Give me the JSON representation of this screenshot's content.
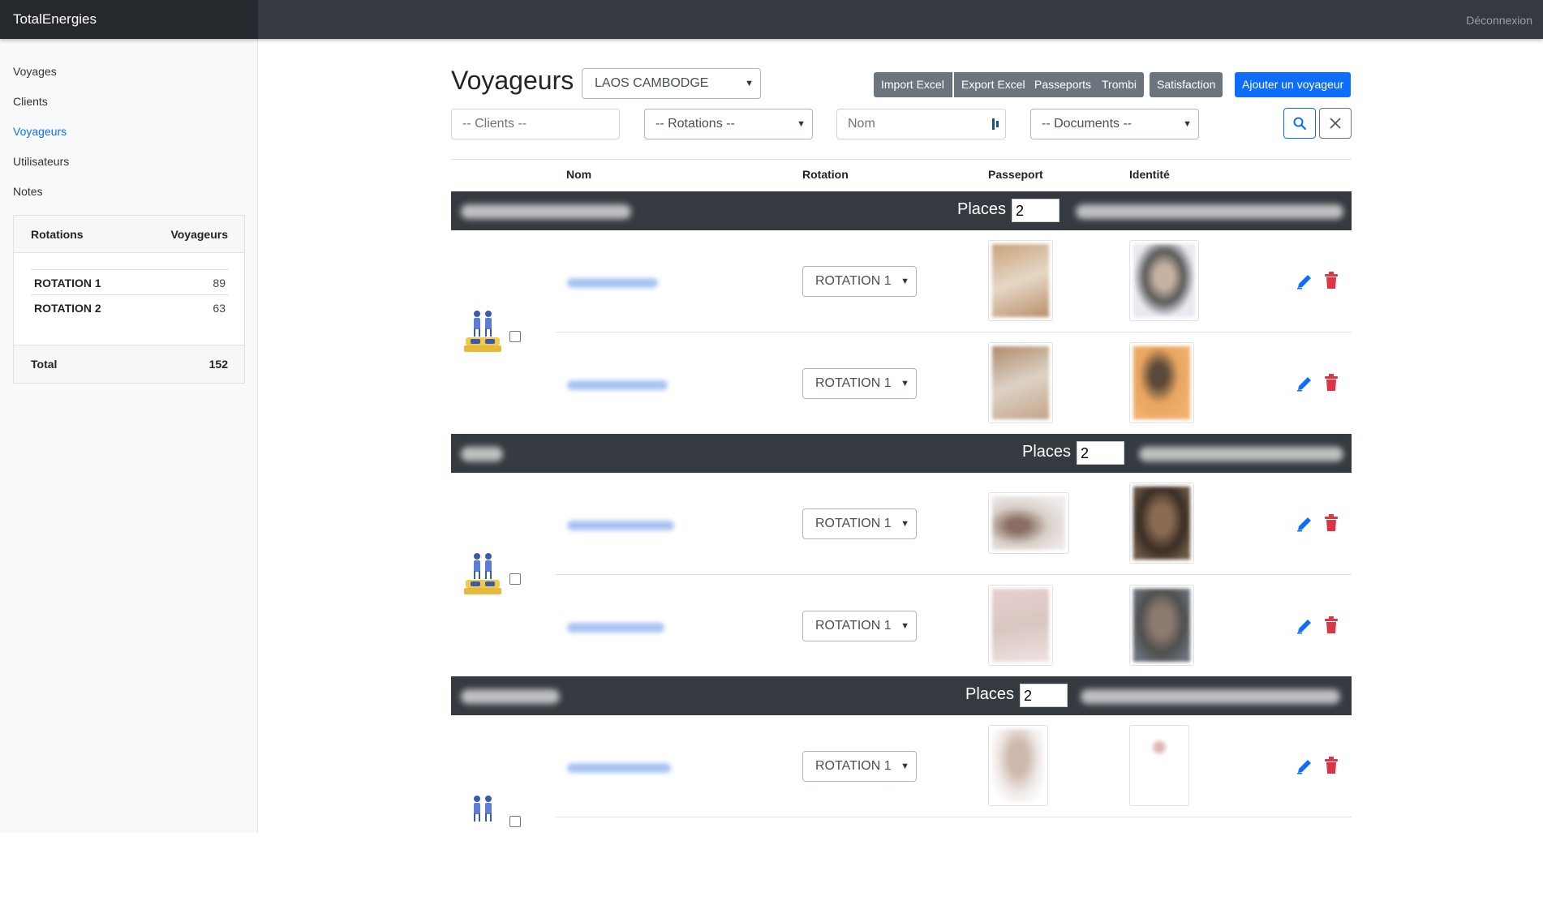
{
  "navbar": {
    "brand": "TotalEnergies",
    "logout": "Déconnexion"
  },
  "sidebar": {
    "items": [
      {
        "label": "Voyages",
        "active": false
      },
      {
        "label": "Clients",
        "active": false
      },
      {
        "label": "Voyageurs",
        "active": true
      },
      {
        "label": "Utilisateurs",
        "active": false
      },
      {
        "label": "Notes",
        "active": false
      }
    ],
    "stats": {
      "col_rotations": "Rotations",
      "col_voyageurs": "Voyageurs",
      "rows": [
        {
          "name": "ROTATION 1",
          "value": "89"
        },
        {
          "name": "ROTATION 2",
          "value": "63"
        }
      ],
      "total_label": "Total",
      "total_value": "152"
    }
  },
  "main": {
    "title": "Voyageurs",
    "trip_select": "LAOS CAMBODGE",
    "toolbar": {
      "import_excel": "Import Excel",
      "export_excel": "Export Excel",
      "passeports": "Passeports",
      "trombi": "Trombi",
      "satisfaction": "Satisfaction",
      "add_traveller": "Ajouter un voyageur"
    },
    "filters": {
      "clients_placeholder": "-- Clients --",
      "rotations": "-- Rotations --",
      "nom_placeholder": "Nom",
      "documents": "-- Documents --"
    },
    "columns": {
      "nom": "Nom",
      "rotation": "Rotation",
      "passeport": "Passeport",
      "identite": "Identité"
    },
    "groups": [
      {
        "places_label": "Places",
        "places_value": "2",
        "rows": [
          {
            "rotation": "ROTATION 1"
          },
          {
            "rotation": "ROTATION 1"
          }
        ]
      },
      {
        "places_label": "Places",
        "places_value": "2",
        "rows": [
          {
            "rotation": "ROTATION 1"
          },
          {
            "rotation": "ROTATION 1"
          }
        ]
      },
      {
        "places_label": "Places",
        "places_value": "2",
        "rows": [
          {
            "rotation": "ROTATION 1"
          }
        ]
      }
    ]
  },
  "colors": {
    "accent": "#0d6efd",
    "dark": "#343a40",
    "danger": "#dc3545",
    "sidebar_bg": "#f8f9fa"
  },
  "icons": [
    "search-icon",
    "close-icon",
    "edit-icon",
    "trash-icon",
    "room-icon",
    "chevron-down-icon",
    "contact-card-icon"
  ]
}
